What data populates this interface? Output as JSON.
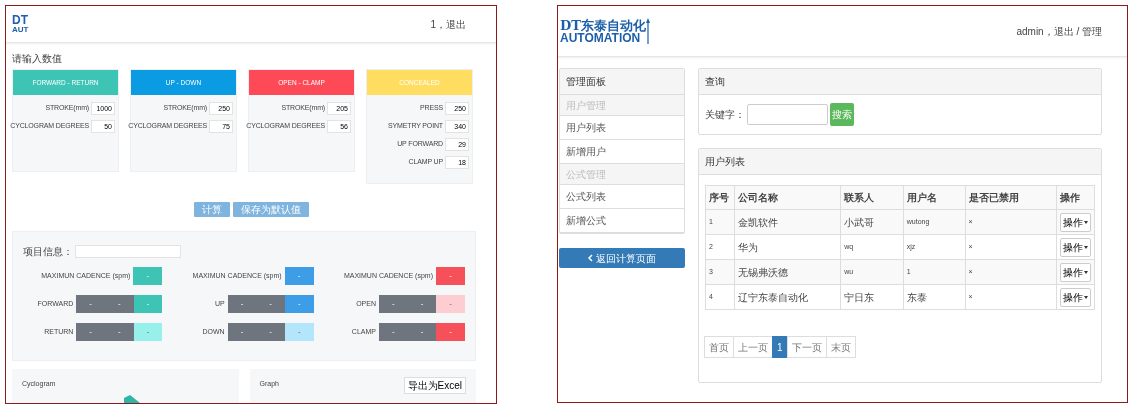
{
  "calculator_page": {
    "logo": {
      "line1": "DT",
      "line2": "AUT"
    },
    "user_menu": "1，退出",
    "prompt": "请输入数值",
    "groups": [
      {
        "title": "FORWARD - RETURN",
        "color": "#3ec4b5",
        "fields": [
          {
            "label": "STROKE(mm)",
            "value": "1000"
          },
          {
            "label": "CYCLOGRAM DEGREES",
            "value": "50"
          }
        ]
      },
      {
        "title": "UP - DOWN",
        "color": "#0a9be3",
        "fields": [
          {
            "label": "STROKE(mm)",
            "value": "250"
          },
          {
            "label": "CYCLOGRAM DEGREES",
            "value": "75"
          }
        ]
      },
      {
        "title": "OPEN - CLAMP",
        "color": "#fe4a57",
        "fields": [
          {
            "label": "STROKE(mm)",
            "value": "205"
          },
          {
            "label": "CYCLOGRAM DEGREES",
            "value": "56"
          }
        ]
      },
      {
        "title": "CONCEALED",
        "color": "#fedd60",
        "fields": [
          {
            "label": "PRESS",
            "value": "250"
          },
          {
            "label": "SYMETRY POINT",
            "value": "340"
          },
          {
            "label": "UP FORWARD",
            "value": "29"
          },
          {
            "label": "CLAMP UP",
            "value": "18"
          }
        ]
      }
    ],
    "buttons": [
      "计算",
      "保存为默认值"
    ],
    "project_info": {
      "label": "项目信息："
    },
    "results": [
      {
        "cadence_label": "MAXIMUN CADENCE (spm)",
        "cadence_value": "-",
        "color": "#3ec4b5",
        "rows": [
          {
            "label": "FORWARD",
            "cells": [
              "-",
              "-",
              "-"
            ],
            "color": "#3ec4b5"
          },
          {
            "label": "RETURN",
            "cells": [
              "-",
              "-",
              "-"
            ],
            "color": "#97f0ea"
          }
        ]
      },
      {
        "cadence_label": "MAXIMUN CADENCE (spm)",
        "cadence_value": "-",
        "color": "#3d9de6",
        "rows": [
          {
            "label": "UP",
            "cells": [
              "-",
              "-",
              "-"
            ],
            "color": "#3d9de6"
          },
          {
            "label": "DOWN",
            "cells": [
              "-",
              "-",
              "-"
            ],
            "color": "#b3e5fb"
          }
        ]
      },
      {
        "cadence_label": "MAXIMUN CADENCE (spm)",
        "cadence_value": "-",
        "color": "#f6505a",
        "rows": [
          {
            "label": "OPEN",
            "cells": [
              "-",
              "-",
              "-"
            ],
            "color": "#fdcdd2"
          },
          {
            "label": "CLAMP",
            "cells": [
              "-",
              "-",
              "-"
            ],
            "color": "#f6505a"
          }
        ]
      }
    ],
    "bottom_panels": [
      {
        "title": "Cyclogram"
      },
      {
        "title": "Graph",
        "button": "导出为Excel"
      }
    ]
  },
  "admin_page": {
    "logo": {
      "line1": "DT东泰自动化",
      "line2": "AUTOMATION"
    },
    "user_menu": "admin，退出 / 管理",
    "sidebar": {
      "title": "管理面板",
      "items": [
        {
          "label": "用户管理",
          "kind": "heading"
        },
        {
          "label": "用户列表",
          "kind": "link"
        },
        {
          "label": "新增用户",
          "kind": "link"
        },
        {
          "label": "公式管理",
          "kind": "heading"
        },
        {
          "label": "公式列表",
          "kind": "link"
        },
        {
          "label": "新增公式",
          "kind": "link"
        }
      ]
    },
    "back_button": "返回计算页面",
    "query": {
      "title": "查询",
      "label": "关键字：",
      "button": "搜索"
    },
    "user_list": {
      "title": "用户列表",
      "columns": [
        "序号",
        "公司名称",
        "联系人",
        "用户名",
        "是否已禁用",
        "操作"
      ],
      "rows": [
        {
          "cells": [
            "1",
            "金凯软件",
            "小武哥",
            "wutong",
            "×"
          ],
          "action": "操作"
        },
        {
          "cells": [
            "2",
            "华为",
            "wq",
            "xjz",
            "×"
          ],
          "action": "操作"
        },
        {
          "cells": [
            "3",
            "无锡弗沃德",
            "wu",
            "1",
            "×"
          ],
          "action": "操作"
        },
        {
          "cells": [
            "4",
            "辽宁东泰自动化",
            "宁日东",
            "东泰",
            "×"
          ],
          "action": "操作"
        }
      ],
      "pagination": [
        {
          "label": "首页",
          "selected": false
        },
        {
          "label": "上一页",
          "selected": false
        },
        {
          "label": "1",
          "selected": true
        },
        {
          "label": "下一页",
          "selected": false
        },
        {
          "label": "末页",
          "selected": false
        }
      ]
    }
  }
}
